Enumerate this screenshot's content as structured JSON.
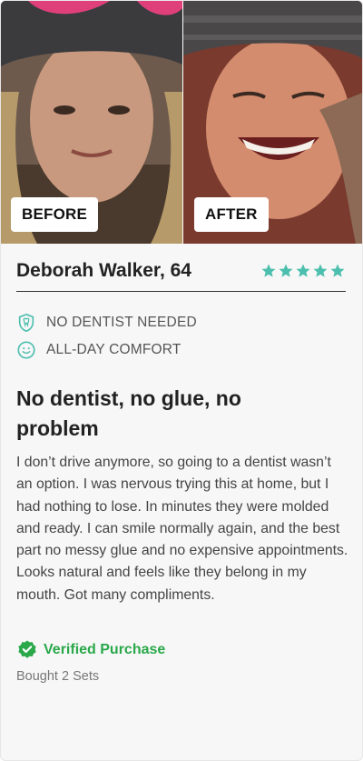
{
  "photos": {
    "before_label": "BEFORE",
    "after_label": "AFTER"
  },
  "reviewer": {
    "name": "Deborah Walker, 64",
    "rating": 5,
    "star_color": "#4dbfae"
  },
  "features": [
    {
      "icon": "tooth-shield-icon",
      "label": "NO DENTIST NEEDED"
    },
    {
      "icon": "smile-icon",
      "label": "ALL-DAY COMFORT"
    }
  ],
  "review": {
    "title": "No dentist, no glue, no problem",
    "body": "I don’t drive anymore, so going to a dentist wasn’t an option. I was nervous trying this at home, but I had nothing to lose. In minutes they were molded and ready. I can smile normally again, and the best part no messy glue and no expensive appointments. Looks natural and feels like they belong in my mouth. Got many compliments."
  },
  "verified": {
    "label": "Verified Purchase",
    "color": "#2aa84a"
  },
  "purchase_note": "Bought 2 Sets"
}
